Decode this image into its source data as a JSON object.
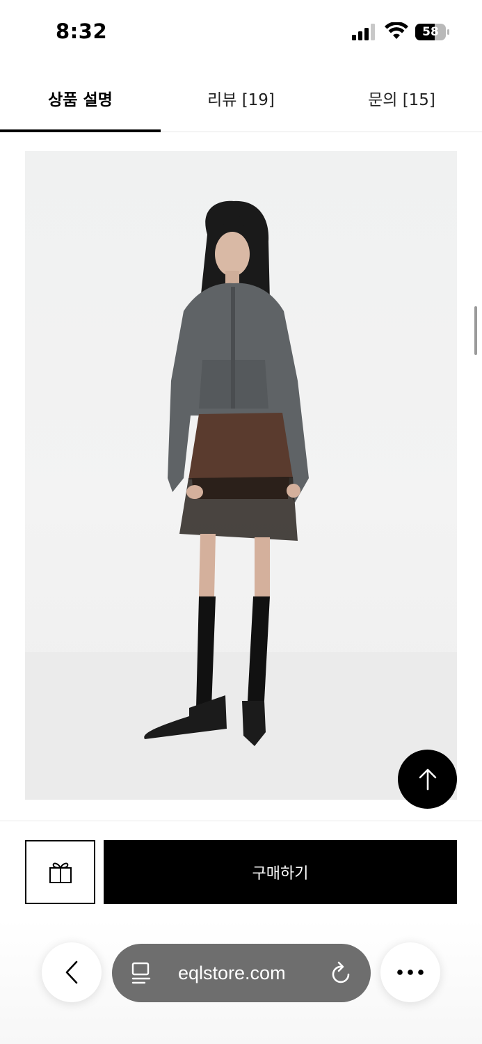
{
  "status_bar": {
    "time": "8:32",
    "battery_level": "58",
    "icons": [
      "signal-icon",
      "wifi-icon",
      "battery-icon"
    ]
  },
  "tabs": [
    {
      "label": "상품 설명",
      "active": true
    },
    {
      "label": "리뷰 [19]",
      "active": false
    },
    {
      "label": "문의 [15]",
      "active": false
    }
  ],
  "product": {
    "image_icon": "product-photo"
  },
  "actions": {
    "gift_icon": "gift-icon",
    "buy_label": "구매하기",
    "scroll_top_icon": "arrow-up-icon"
  },
  "browser": {
    "url": "eqlstore.com",
    "icons": [
      "chevron-left-icon",
      "reader-icon",
      "reload-icon",
      "more-icon"
    ]
  },
  "colors": {
    "primary": "#000000",
    "background": "#ffffff",
    "url_pill": "#6e6e6e"
  }
}
